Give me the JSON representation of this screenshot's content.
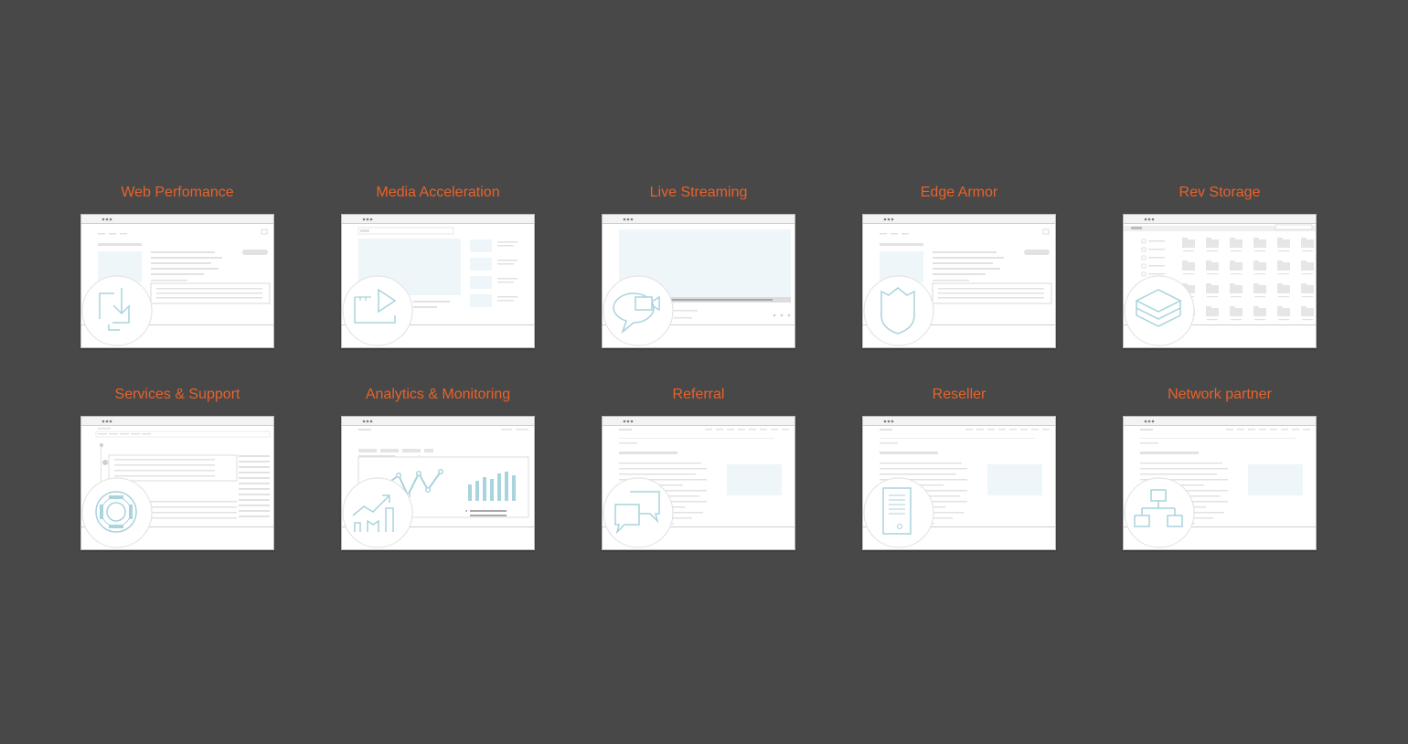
{
  "colors": {
    "background": "#484848",
    "title": "#e8622a",
    "wire": "#e2e2e2",
    "wire_dark": "#cfcfcf",
    "accent_fill": "#eef6f9",
    "icon_stroke": "#a9d3dd"
  },
  "tiles": [
    {
      "title": "Web Perfomance",
      "icon": "download-icon",
      "wireframe": "product-page"
    },
    {
      "title": "Media Acceleration",
      "icon": "play-icon",
      "wireframe": "video-page"
    },
    {
      "title": "Live Streaming",
      "icon": "chat-camera-icon",
      "wireframe": "player-page"
    },
    {
      "title": "Edge Armor",
      "icon": "shield-icon",
      "wireframe": "product-page"
    },
    {
      "title": "Rev Storage",
      "icon": "layers-icon",
      "wireframe": "folders-page"
    },
    {
      "title": "Services & Support",
      "icon": "lifebuoy-icon",
      "wireframe": "tickets-page"
    },
    {
      "title": "Analytics & Monitoring",
      "icon": "chart-icon",
      "wireframe": "dashboard-page"
    },
    {
      "title": "Referral",
      "icon": "chat-bubbles-icon",
      "wireframe": "landing-page"
    },
    {
      "title": "Reseller",
      "icon": "document-icon",
      "wireframe": "landing-page"
    },
    {
      "title": "Network partner",
      "icon": "network-icon",
      "wireframe": "landing-page"
    }
  ]
}
